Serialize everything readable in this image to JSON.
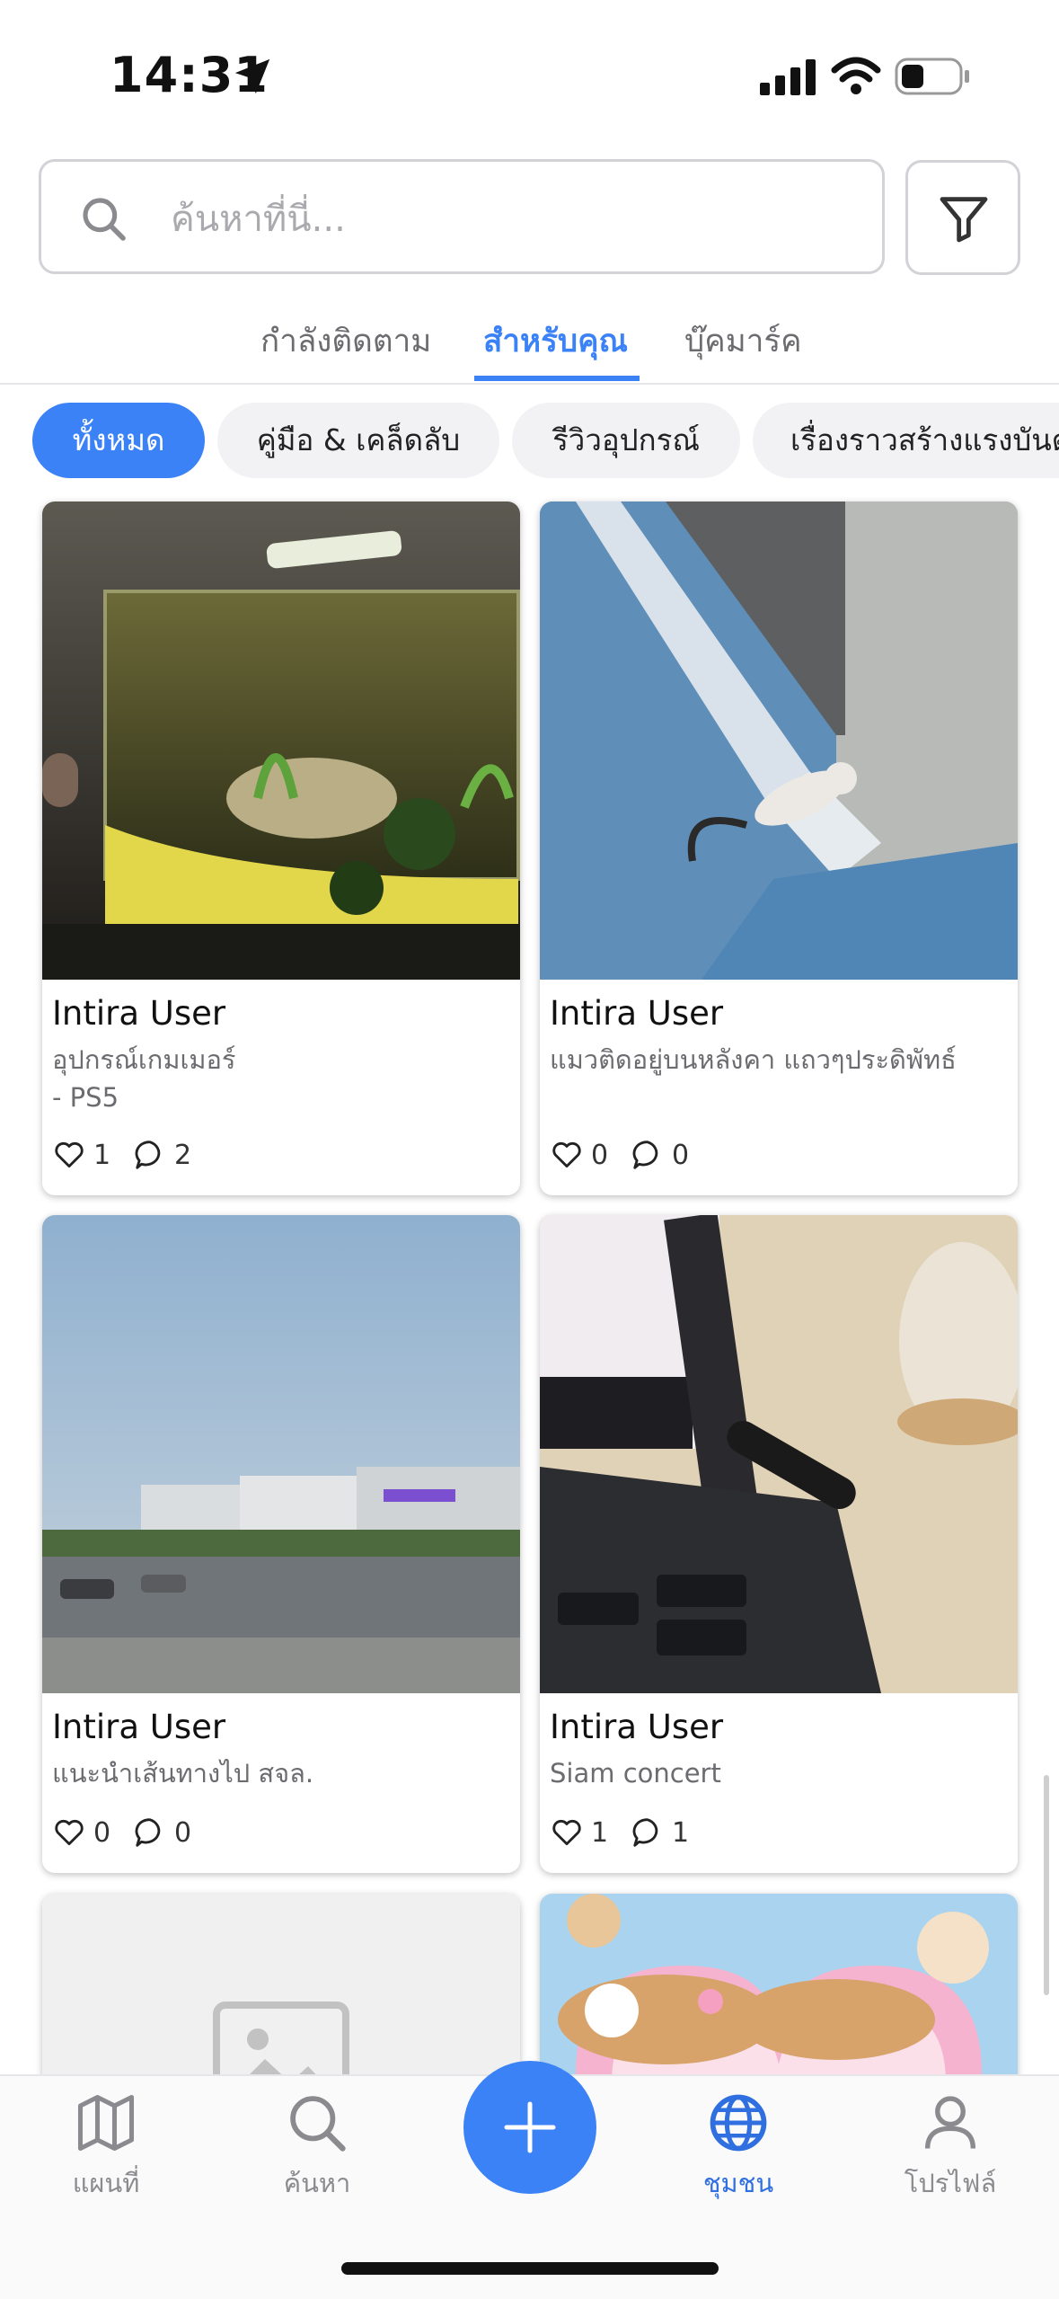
{
  "status_bar": {
    "time": "14:31"
  },
  "search": {
    "placeholder": "ค้นหาที่นี่..."
  },
  "tabs": [
    {
      "label": "กำลังติดตาม"
    },
    {
      "label": "สำหรับคุณ"
    },
    {
      "label": "บุ๊คมาร์ค"
    }
  ],
  "active_tab": "สำหรับคุณ",
  "chips": [
    {
      "label": "ทั้งหมด"
    },
    {
      "label": "คู่มือ & เคล็ดลับ"
    },
    {
      "label": "รีวิวอุปกรณ์"
    },
    {
      "label": "เรื่องราวสร้างแรงบันดาลใจ"
    }
  ],
  "posts": [
    {
      "author": "Intira User",
      "desc_line1": "อุปกรณ์เกมเมอร์",
      "desc_line2": "- PS5",
      "likes": "1",
      "comments": "2",
      "photo": "aquarium"
    },
    {
      "author": "Intira User",
      "desc_line1": "แมวติดอยู่บนหลังคา แถวๆประดิพัทธ์",
      "desc_line2": "",
      "likes": "0",
      "comments": "0",
      "photo": "cat-on-roof"
    },
    {
      "author": "Intira User",
      "desc_line1": "แนะนำเส้นทางไป สจล.",
      "desc_line2": "",
      "likes": "0",
      "comments": "0",
      "photo": "highway-sky"
    },
    {
      "author": "Intira User",
      "desc_line1": "Siam concert",
      "desc_line2": "",
      "likes": "1",
      "comments": "1",
      "photo": "laptop-keyboard"
    },
    {
      "photo": "image-placeholder-icon"
    },
    {
      "photo": "cartoon-dog"
    }
  ],
  "nav": {
    "map": "แผนที่",
    "search": "ค้นหา",
    "community": "ชุมชน",
    "profile": "โปรไฟล์"
  },
  "colors": {
    "accent": "#3b82f6",
    "text_muted": "#6b6b70"
  }
}
